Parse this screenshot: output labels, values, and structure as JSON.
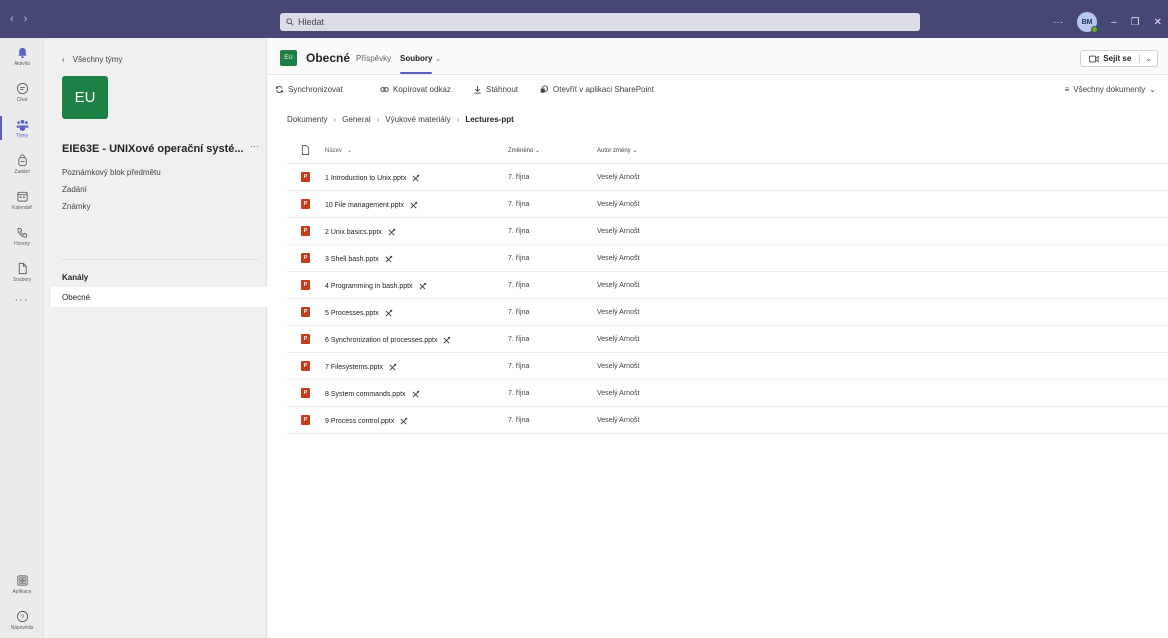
{
  "titlebar": {
    "search_placeholder": "Hledat",
    "avatar_initials": "BM",
    "more": "···"
  },
  "rail": {
    "items": [
      {
        "label": "Aktivita"
      },
      {
        "label": "Chat"
      },
      {
        "label": "Týmy"
      },
      {
        "label": "Zadání"
      },
      {
        "label": "Kalendář"
      },
      {
        "label": "Hovory"
      },
      {
        "label": "Soubory"
      }
    ],
    "more": "···",
    "apps": "Aplikace",
    "help": "Nápověda"
  },
  "team": {
    "back_label": "Všechny týmy",
    "tile": "EU",
    "name": "EIE63E - UNIXové operační systé...",
    "more": "···",
    "links": [
      "Poznámkový blok předmětu",
      "Zadání",
      "Známky"
    ],
    "channels_heading": "Kanály",
    "channels": [
      "Obecné"
    ]
  },
  "header": {
    "icon": "EU",
    "channel": "Obecné",
    "tabs": [
      "Příspěvky",
      "Soubory"
    ],
    "meet": "Sejít se"
  },
  "toolbar": {
    "sync": "Synchronizovat",
    "copy_link": "Kopírovat odkaz",
    "download": "Stáhnout",
    "open_sp": "Otevřít v aplikaci SharePoint",
    "all_docs": "Všechny dokumenty"
  },
  "breadcrumb": [
    "Dokumenty",
    "General",
    "Výukové materiály",
    "Lectures-ppt"
  ],
  "table": {
    "headers": {
      "name": "Název",
      "modified": "Změněno",
      "author": "Autor změny"
    },
    "rows": [
      {
        "name": "1 Introduction to Unix.pptx",
        "modified": "7. října",
        "author": "Veselý Arnošt"
      },
      {
        "name": "10 File management.pptx",
        "modified": "7. října",
        "author": "Veselý Arnošt"
      },
      {
        "name": "2 Unix basics.pptx",
        "modified": "7. října",
        "author": "Veselý Arnošt"
      },
      {
        "name": "3 Shell bash.pptx",
        "modified": "7. října",
        "author": "Veselý Arnošt"
      },
      {
        "name": "4 Programming in bash.pptx",
        "modified": "7. října",
        "author": "Veselý Arnošt"
      },
      {
        "name": "5 Processes.pptx",
        "modified": "7. října",
        "author": "Veselý Arnošt"
      },
      {
        "name": "6 Synchronization of processes.pptx",
        "modified": "7. října",
        "author": "Veselý Arnošt"
      },
      {
        "name": "7 Filesystems.pptx",
        "modified": "7. října",
        "author": "Veselý Arnošt"
      },
      {
        "name": "8 System commands.pptx",
        "modified": "7. října",
        "author": "Veselý Arnošt"
      },
      {
        "name": "9 Process control.pptx",
        "modified": "7. října",
        "author": "Veselý Arnošt"
      }
    ]
  }
}
